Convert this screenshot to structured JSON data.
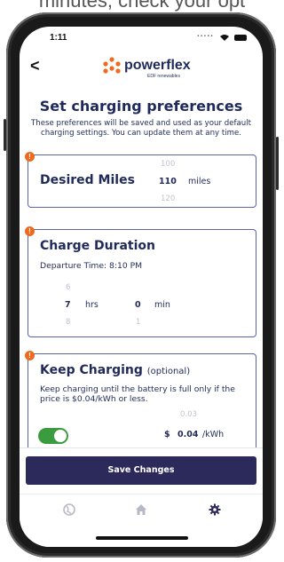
{
  "caption": "minutes, check your opt",
  "status_bar": {
    "time": "1:11",
    "signal": "....."
  },
  "header": {
    "back": "<",
    "brand": "powerflex",
    "brand_sub": "EDF renewables"
  },
  "page": {
    "title": "Set charging preferences",
    "subtitle": "These preferences will be saved and used as your default charging settings. You can update them at any time."
  },
  "desired_miles": {
    "title": "Desired Miles",
    "prev": "100",
    "value": "110",
    "next": "120",
    "unit": "miles"
  },
  "charge_duration": {
    "title": "Charge Duration",
    "departure": "Departure Time: 8:10 PM",
    "hours_prev": "6",
    "hours": "7",
    "hours_next": "8",
    "hours_unit": "hrs",
    "min_prev": "",
    "min": "0",
    "min_next": "1",
    "min_unit": "min"
  },
  "keep_charging": {
    "title": "Keep Charging",
    "optional": "(optional)",
    "description": "Keep charging until the battery is full only if the price is $0.04/kWh or less.",
    "price_prev": "0.03",
    "currency": "$",
    "price": "0.04",
    "price_unit": "/kWh",
    "toggle_on": true
  },
  "actions": {
    "save": "Save Changes"
  },
  "nav": [
    "globe-icon",
    "home-icon",
    "gear-icon"
  ],
  "colors": {
    "navy": "#1f2a5a",
    "button": "#2c2a5a",
    "accent_orange": "#f06a1d",
    "toggle_green": "#3a9b3f",
    "card_border": "#5b63a8"
  }
}
